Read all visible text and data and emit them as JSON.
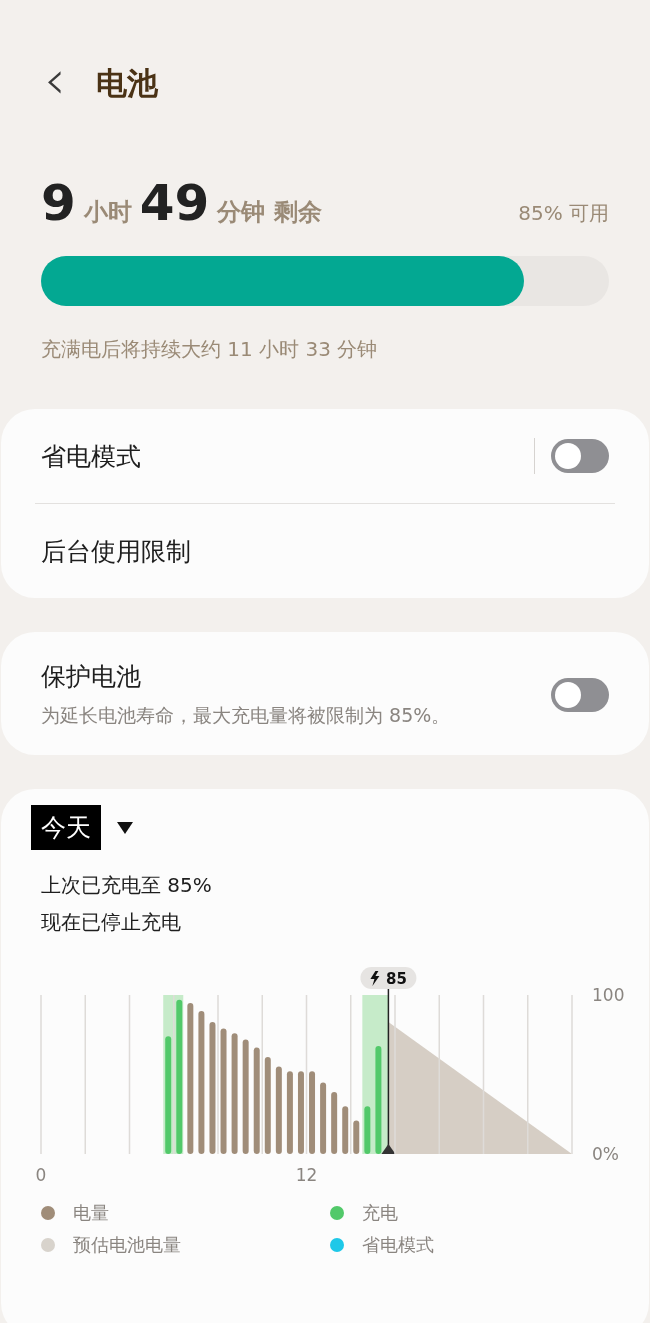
{
  "header": {
    "back_icon": "‹",
    "title": "电池"
  },
  "summary": {
    "hours": "9",
    "hours_unit": "小时",
    "minutes": "49",
    "minutes_unit": "分钟 剩余",
    "available": "85% 可用",
    "level": 0.85,
    "full_charge_note": "充满电后将持续大约 11 小时 33 分钟"
  },
  "settings_card": [
    {
      "kind": "toggle",
      "label": "省电模式",
      "on": false
    },
    {
      "kind": "link",
      "label": "后台使用限制"
    }
  ],
  "protect_card": {
    "label": "保护电池",
    "description": "为延长电池寿命，最大充电量将被限制为 85%。",
    "on": false
  },
  "usage": {
    "period": "今天",
    "status_lines": [
      "上次已充电至 85%",
      "现在已停止充电"
    ],
    "chart_data": {
      "type": "bar",
      "x": [
        5.75,
        6.25,
        6.75,
        7.25,
        7.75,
        8.25,
        8.75,
        9.25,
        9.75,
        10.25,
        10.75,
        11.25,
        11.75,
        12.25,
        12.75,
        13.25,
        13.75,
        14.25,
        14.75,
        15.25
      ],
      "xlim": [
        0,
        24
      ],
      "ylim": [
        0,
        100
      ],
      "xticks": [
        {
          "value": 0,
          "label": "0"
        },
        {
          "value": 12,
          "label": "12"
        }
      ],
      "yticks": [
        {
          "value": 0,
          "label": "0%"
        },
        {
          "value": 100,
          "label": "100"
        }
      ],
      "series": [
        {
          "name": "电量",
          "color": "#a08d79",
          "values": [
            null,
            null,
            95,
            90,
            83,
            79,
            76,
            72,
            67,
            61,
            55,
            52,
            52,
            52,
            45,
            39,
            30,
            21,
            null,
            null
          ]
        },
        {
          "name": "充电",
          "color": "#52c96a",
          "values": [
            74,
            97,
            null,
            null,
            null,
            null,
            null,
            null,
            null,
            null,
            null,
            null,
            null,
            null,
            null,
            null,
            null,
            null,
            30,
            68
          ]
        }
      ],
      "annotations": [
        "85"
      ]
    },
    "legend_extra": [
      {
        "label": "预估电池电量",
        "color": "#d8d3cc"
      },
      {
        "label": "省电模式",
        "color": "#1ec8e8"
      }
    ]
  }
}
